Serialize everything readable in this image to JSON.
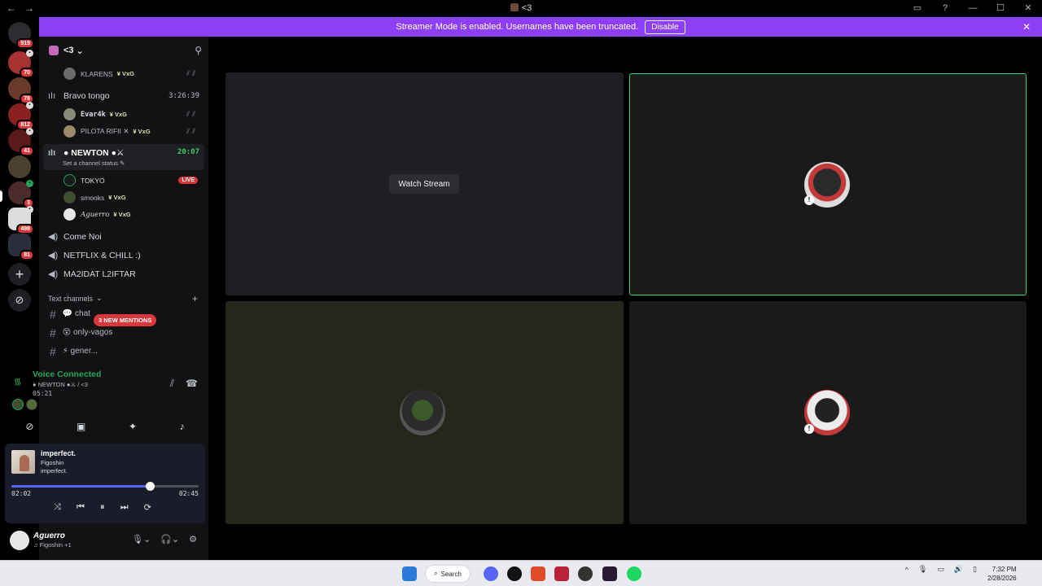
{
  "window": {
    "title": "<3",
    "back_icon": "←",
    "forward_icon": "→"
  },
  "banner": {
    "text": "Streamer Mode is enabled. Usernames have been truncated.",
    "disable_label": "Disable",
    "close_icon": "✕"
  },
  "rail": {
    "badges": [
      "919",
      "70",
      "78",
      "812",
      "41",
      "3",
      "498",
      "81"
    ],
    "add_icon": "+",
    "discover_icon": "⊘"
  },
  "guild": {
    "name": "<3",
    "chevron": "⌄"
  },
  "channels": {
    "voice_rows": [
      {
        "type": "user",
        "name": "KLARENS",
        "tag": "¥ VxG",
        "muted": "⫽⫽"
      },
      {
        "type": "voice",
        "name": "Bravo tongo",
        "time": "3:26:39"
      },
      {
        "type": "user",
        "name": "Evar4k",
        "tag": "¥ VxG",
        "muted": "⫽⫽"
      },
      {
        "type": "user",
        "name": "PILOTA RIFII ✕",
        "tag": "¥ VxG",
        "muted": "⫽⫽"
      },
      {
        "type": "voice-active",
        "name": "● NEWTON ●⚔",
        "time": "20:07",
        "status": "Set a channel status ✎"
      },
      {
        "type": "user",
        "name": "TOKYO",
        "live": "LIVE"
      },
      {
        "type": "user",
        "name": "smooks",
        "tag": "¥ VxG"
      },
      {
        "type": "user",
        "name": "Aguerro",
        "tag": "¥ VxG"
      },
      {
        "type": "voice",
        "name": "Come Noi"
      },
      {
        "type": "voice",
        "name": "NETFLIX & CHILL :)"
      },
      {
        "type": "voice",
        "name": "MA2IDAT L2IFTAR"
      }
    ],
    "text_category": "Text channels",
    "text_channels": [
      {
        "name": "💬 chat"
      },
      {
        "name": "😵 only-vagos"
      },
      {
        "name": "⚡ gener..."
      }
    ],
    "mentions_pill": "3 NEW MENTIONS"
  },
  "voice_panel": {
    "title": "Voice Connected",
    "subtitle": "● NEWTON ●⚔ / <3",
    "elapsed": "05:21"
  },
  "player": {
    "track": "imperfect.",
    "artist": "Figoshin",
    "album": "imperfect.",
    "current": "02:02",
    "duration": "02:45",
    "progress": 0.74
  },
  "user_panel": {
    "name": "Aguerro",
    "status": "♫ Figoshin +1"
  },
  "stage": {
    "watch_label": "Watch Stream"
  },
  "taskbar": {
    "search_label": "Search",
    "time": "7:32 PM",
    "date": "2/28/2026"
  },
  "colors": {
    "banner": "#8d3ef7",
    "speaking_border": "#3fd07a",
    "live_badge": "#da373c",
    "voice_connected": "#23a55a",
    "progress_fill": "#5865f2"
  }
}
